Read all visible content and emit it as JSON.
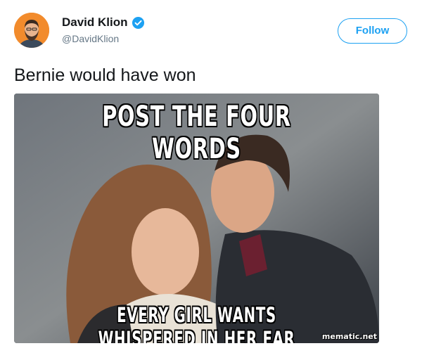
{
  "author": {
    "display_name": "David Klion",
    "handle": "@DavidKlion",
    "verified": true,
    "avatar_icon": "avatar-bearded-man"
  },
  "follow_label": "Follow",
  "tweet_text": "Bernie would have won",
  "media": {
    "meme_top_text": "POST THE FOUR WORDS",
    "meme_bottom_text": "EVERY GIRL WANTS WHISPERED IN HER EAR",
    "watermark": "mematic.net"
  },
  "colors": {
    "accent": "#1da1f2",
    "text": "#14171a",
    "secondary_text": "#657786",
    "avatar_bg": "#f28b2c"
  }
}
